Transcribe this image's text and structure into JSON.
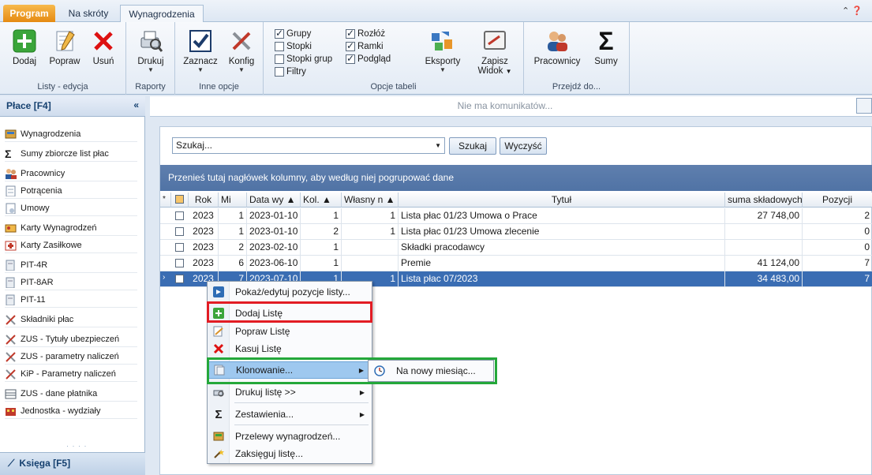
{
  "tabs": [
    "Program",
    "Na skróty",
    "Wynagrodzenia"
  ],
  "ribbon": {
    "groups": [
      {
        "label": "Listy - edycja",
        "buttons": [
          "Dodaj",
          "Popraw",
          "Usuń"
        ]
      },
      {
        "label": "Raporty",
        "buttons": [
          "Drukuj"
        ]
      },
      {
        "label": "Inne opcje",
        "buttons": [
          "Zaznacz",
          "Konfig"
        ]
      },
      {
        "label": "Opcje tabeli"
      },
      {
        "label": "Przejdź do...",
        "buttons": [
          "Pracownicy",
          "Sumy"
        ]
      }
    ],
    "checkboxes": [
      {
        "label": "Grupy",
        "checked": true
      },
      {
        "label": "Stopki",
        "checked": false
      },
      {
        "label": "Stopki grup",
        "checked": false
      },
      {
        "label": "Filtry",
        "checked": false
      },
      {
        "label": "Rozłóż",
        "checked": true
      },
      {
        "label": "Ramki",
        "checked": true
      },
      {
        "label": "Podgląd",
        "checked": true
      }
    ],
    "eksporty": "Eksporty",
    "zapisz1": "Zapisz",
    "zapisz2": "Widok"
  },
  "sidebar": {
    "title": "Płace [F4]",
    "collapse": "«",
    "items": [
      "Wynagrodzenia",
      "Sumy zbiorcze list płac",
      "Pracownicy",
      "Potrącenia",
      "Umowy",
      "Karty Wynagrodzeń",
      "Karty Zasiłkowe",
      "PIT-4R",
      "PIT-8AR",
      "PIT-11",
      "Składniki płac",
      "ZUS - Tytuły ubezpieczeń",
      "ZUS - parametry naliczeń",
      "KiP - Parametry naliczeń",
      "ZUS - dane płatnika",
      "Jednostka - wydziały"
    ],
    "footer": "Księga [F5]"
  },
  "message": "Nie ma komunikatów...",
  "search": {
    "value": "Szukaj...",
    "button": "Szukaj",
    "clear": "Wyczyść"
  },
  "groupbar": "Przenieś tutaj nagłówek kolumny, aby według niej pogrupować dane",
  "grid": {
    "columns": [
      "Rok",
      "Mi",
      "Data wy ▲",
      "Kol. ▲",
      "Własny n ▲",
      "Tytuł",
      "suma składowych",
      "Pozycji"
    ],
    "rows": [
      [
        "2023",
        "1",
        "2023-01-10",
        "1",
        "1",
        "Lista płac 01/23 Umowa o Prace",
        "27 748,00",
        "2"
      ],
      [
        "2023",
        "1",
        "2023-01-10",
        "2",
        "1",
        "Lista płac 01/23 Umowa zlecenie",
        "",
        "0"
      ],
      [
        "2023",
        "2",
        "2023-02-10",
        "1",
        "",
        "Składki pracodawcy",
        "",
        "0"
      ],
      [
        "2023",
        "6",
        "2023-06-10",
        "1",
        "",
        "Premie",
        "41 124,00",
        "7"
      ],
      [
        "2023",
        "7",
        "2023-07-10",
        "1",
        "1",
        "Lista płac 07/2023",
        "34 483,00",
        "7"
      ]
    ]
  },
  "context_menu": {
    "items": [
      "Pokaż/edytuj pozycje listy...",
      "Dodaj Listę",
      "Popraw Listę",
      "Kasuj Listę",
      "Klonowanie...",
      "Drukuj listę >>",
      "Zestawienia...",
      "Przelewy wynagrodzeń...",
      "Zaksięguj listę..."
    ],
    "submenu": "Na nowy miesiąc..."
  },
  "colors": {
    "accent": "#3a6db3",
    "highlight_red": "#e21c24",
    "highlight_green": "#24a83a"
  }
}
